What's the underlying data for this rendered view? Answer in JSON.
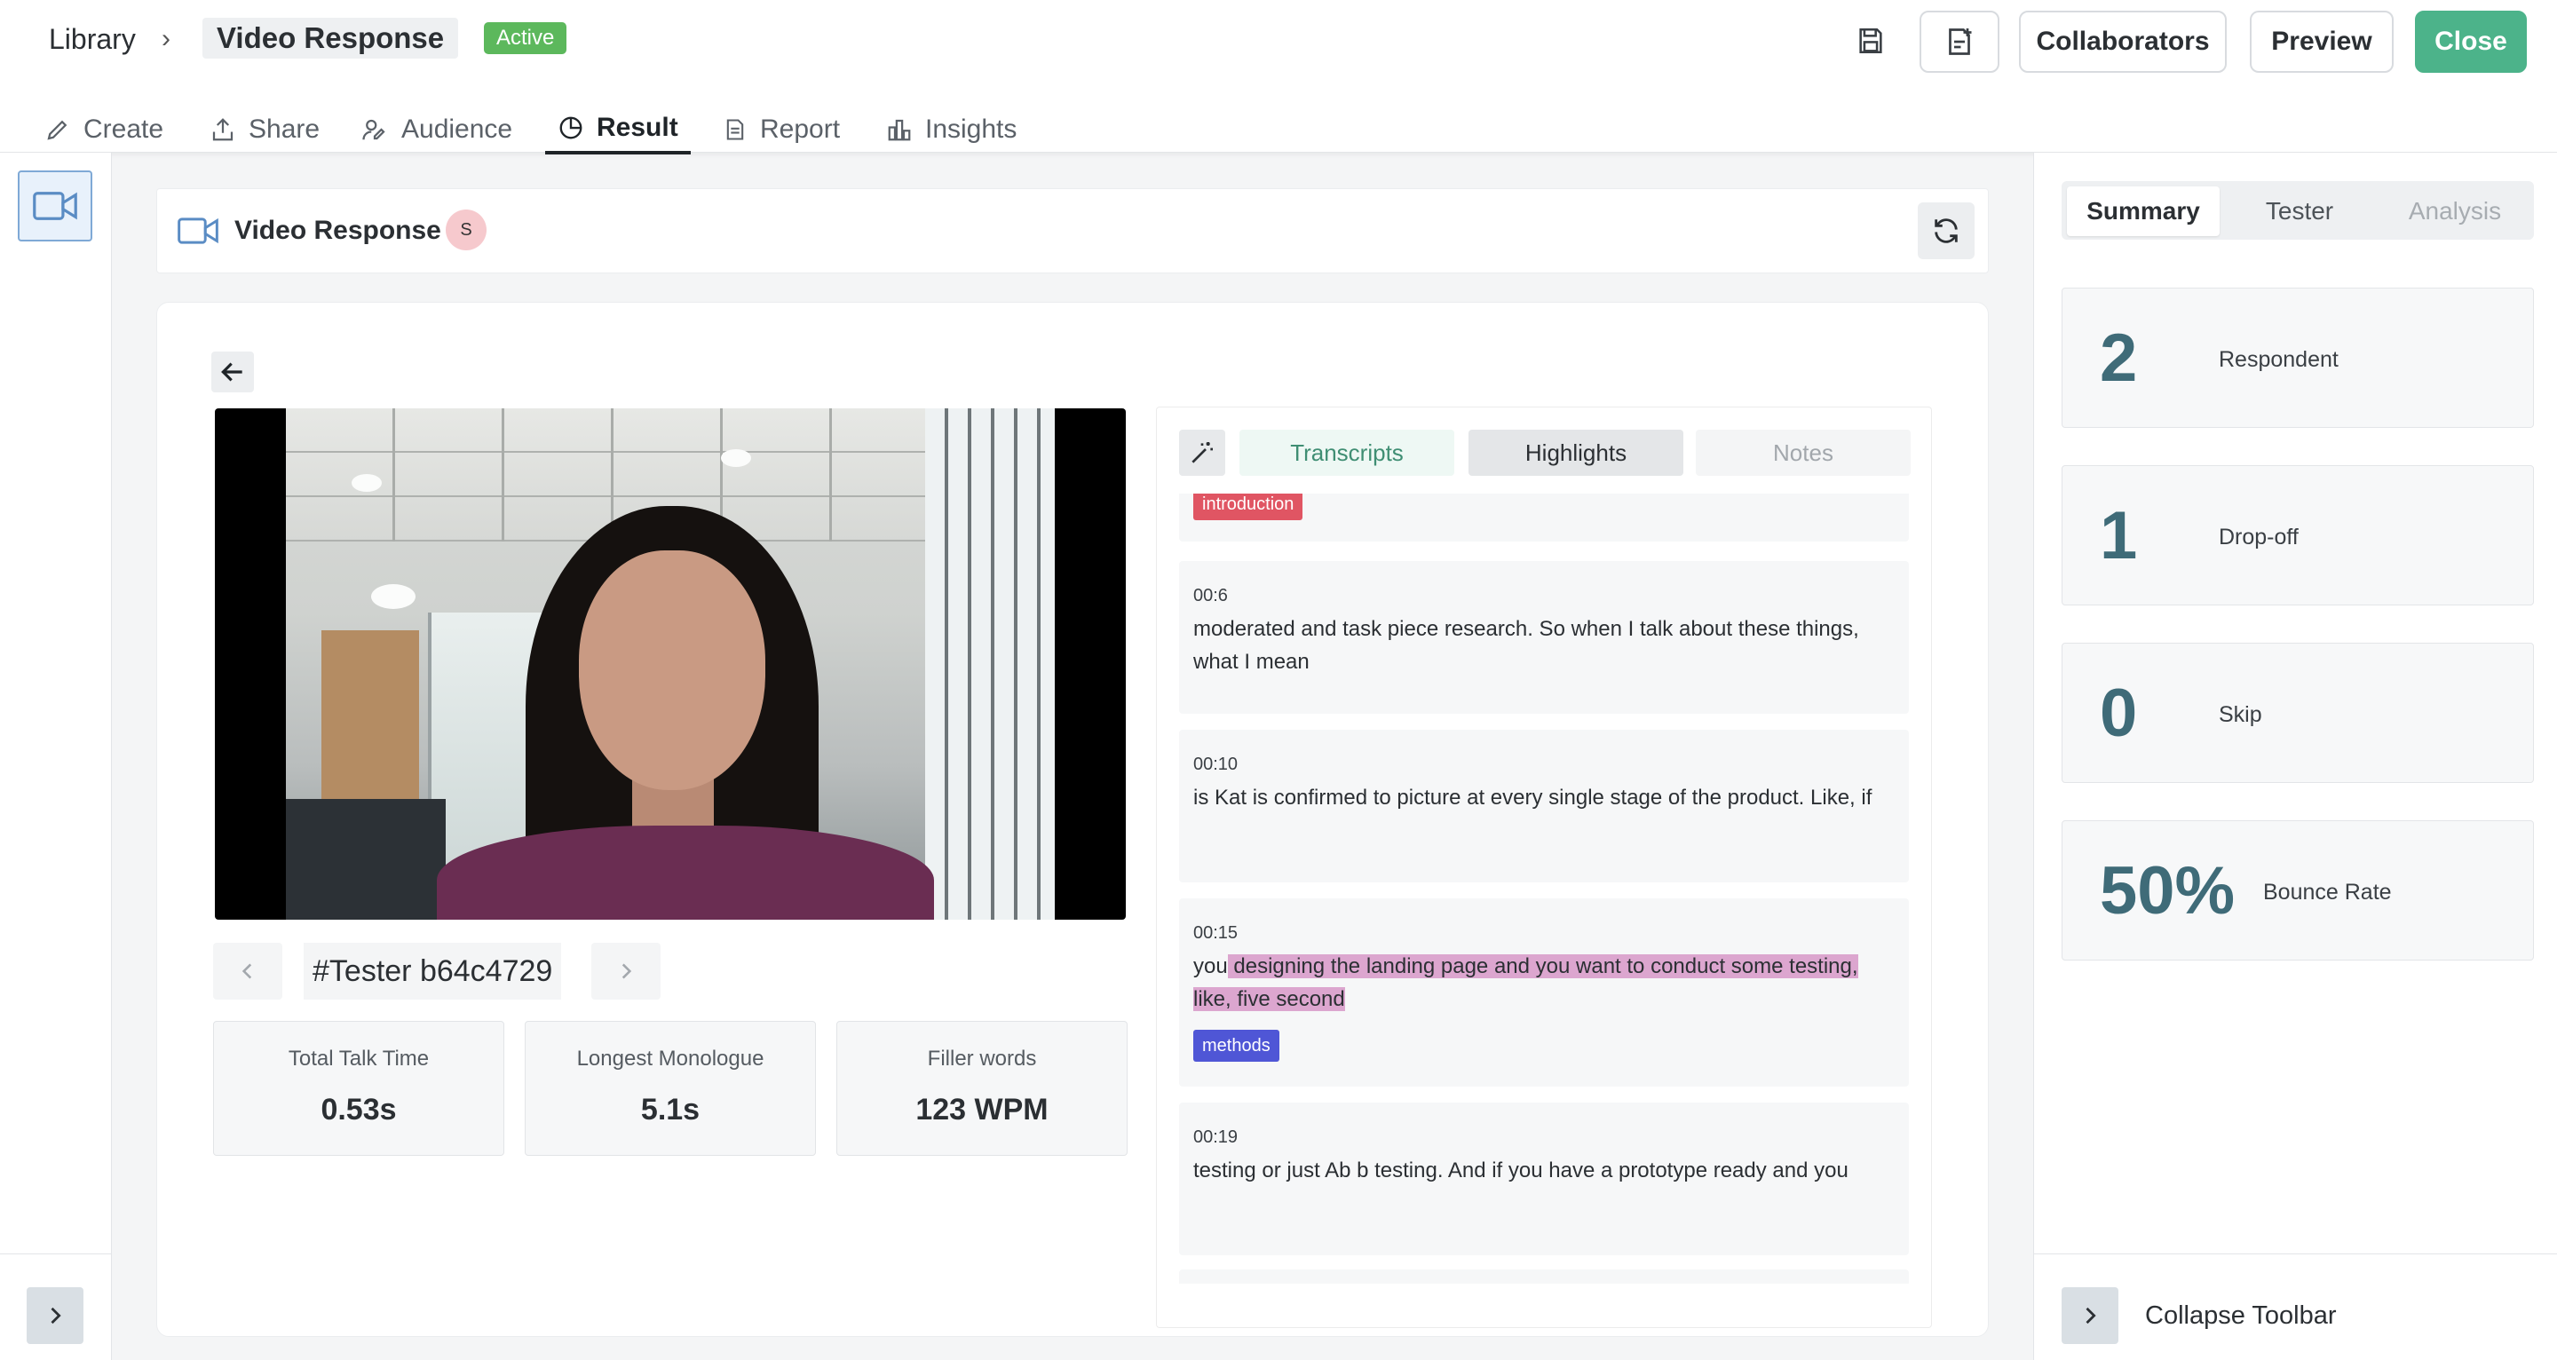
{
  "breadcrumb": {
    "root": "Library",
    "separator": "›",
    "current": "Video Response",
    "status": "Active"
  },
  "header_buttons": {
    "collaborators": "Collaborators",
    "preview": "Preview",
    "close": "Close"
  },
  "nav_tabs": [
    {
      "label": "Create",
      "icon": "pencil-icon"
    },
    {
      "label": "Share",
      "icon": "share-icon"
    },
    {
      "label": "Audience",
      "icon": "audience-icon"
    },
    {
      "label": "Result",
      "icon": "pie-chart-icon",
      "active": true
    },
    {
      "label": "Report",
      "icon": "document-icon"
    },
    {
      "label": "Insights",
      "icon": "bar-chart-icon"
    }
  ],
  "main": {
    "title": "Video Response",
    "avatar_initial": "S",
    "tester_id": "#Tester b64c4729",
    "metrics": [
      {
        "label": "Total Talk Time",
        "value": "0.53s"
      },
      {
        "label": "Longest Monologue",
        "value": "5.1s"
      },
      {
        "label": "Filler words",
        "value": "123 WPM"
      }
    ]
  },
  "transcript_panel": {
    "tabs": [
      "Transcripts",
      "Highlights",
      "Notes"
    ],
    "items": [
      {
        "tag": "introduction"
      },
      {
        "time": "00:6",
        "text": "moderated and task piece research. So when I talk about these things, what I mean"
      },
      {
        "time": "00:10",
        "text": "is Kat is confirmed to picture at every single stage of the product. Like, if"
      },
      {
        "time": "00:15",
        "text_before": "you",
        "text_highlight": " designing the landing page and you want to conduct some testing, like, five second",
        "tag": "methods"
      },
      {
        "time": "00:19",
        "text": "testing or just Ab b testing. And if you have a prototype ready and you"
      }
    ]
  },
  "summary_panel": {
    "tabs": [
      "Summary",
      "Tester",
      "Analysis"
    ],
    "stats": [
      {
        "value": "2",
        "label": "Respondent"
      },
      {
        "value": "1",
        "label": "Drop-off"
      },
      {
        "value": "0",
        "label": "Skip"
      },
      {
        "value": "50%",
        "label": "Bounce Rate"
      }
    ],
    "collapse_label": "Collapse Toolbar"
  },
  "colors": {
    "accent_green": "#4cb38a",
    "active_badge": "#5cb85c",
    "stat_number": "#3f6b78",
    "tag_introduction": "#e05563",
    "tag_methods": "#4f56d6",
    "highlight": "#dca6cf"
  }
}
